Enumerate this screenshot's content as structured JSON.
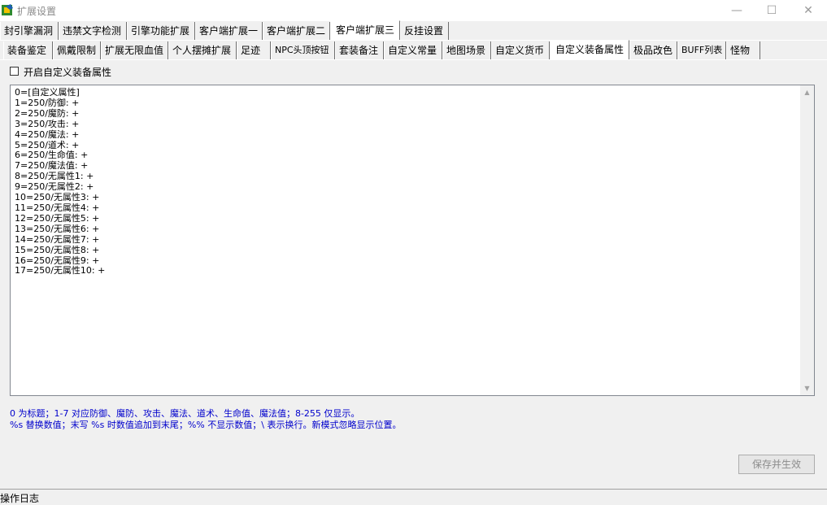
{
  "window": {
    "title": "扩展设置",
    "minimize_glyph": "—",
    "maximize_glyph": "☐",
    "close_glyph": "✕"
  },
  "tabs_row1": [
    {
      "label": "封引擎漏洞"
    },
    {
      "label": "违禁文字检测"
    },
    {
      "label": "引擎功能扩展"
    },
    {
      "label": "客户端扩展一"
    },
    {
      "label": "客户端扩展二"
    },
    {
      "label": "客户端扩展三",
      "active": true
    },
    {
      "label": "反挂设置"
    }
  ],
  "tabs_row2": [
    {
      "label": "装备鉴定"
    },
    {
      "label": "佩戴限制"
    },
    {
      "label": "扩展无限血值"
    },
    {
      "label": "个人摆摊扩展"
    },
    {
      "label": "足迹"
    },
    {
      "label": "NPC头顶按钮"
    },
    {
      "label": "套装备注"
    },
    {
      "label": "自定义常量"
    },
    {
      "label": "地图场景"
    },
    {
      "label": "自定义货币"
    },
    {
      "label": "自定义装备属性",
      "active": true
    },
    {
      "label": "极品改色"
    },
    {
      "label": "BUFF列表"
    },
    {
      "label": "怪物"
    }
  ],
  "enable_checkbox": {
    "label": "开启自定义装备属性",
    "checked": false
  },
  "editor": {
    "content": "0=[自定义属性]\n1=250/防御: +\n2=250/魔防: +\n3=250/攻击: +\n4=250/魔法: +\n5=250/道术: +\n6=250/生命值: +\n7=250/魔法值: +\n8=250/无属性1: +\n9=250/无属性2: +\n10=250/无属性3: +\n11=250/无属性4: +\n12=250/无属性5: +\n13=250/无属性6: +\n14=250/无属性7: +\n15=250/无属性8: +\n16=250/无属性9: +\n17=250/无属性10: +"
  },
  "hints": {
    "line1": "0 为标题；1-7 对应防御、魔防、攻击、魔法、道术、生命值、魔法值；8-255 仅显示。",
    "line2": "%s 替换数值；末写 %s 时数值追加到末尾；%% 不显示数值；\\ 表示换行。新模式忽略显示位置。"
  },
  "save_button": {
    "label": "保存并生效"
  },
  "status_bar": {
    "text": "操作日志"
  },
  "colors": {
    "hint_text": "#0000cc",
    "disabled_text": "#8c8c8c"
  }
}
